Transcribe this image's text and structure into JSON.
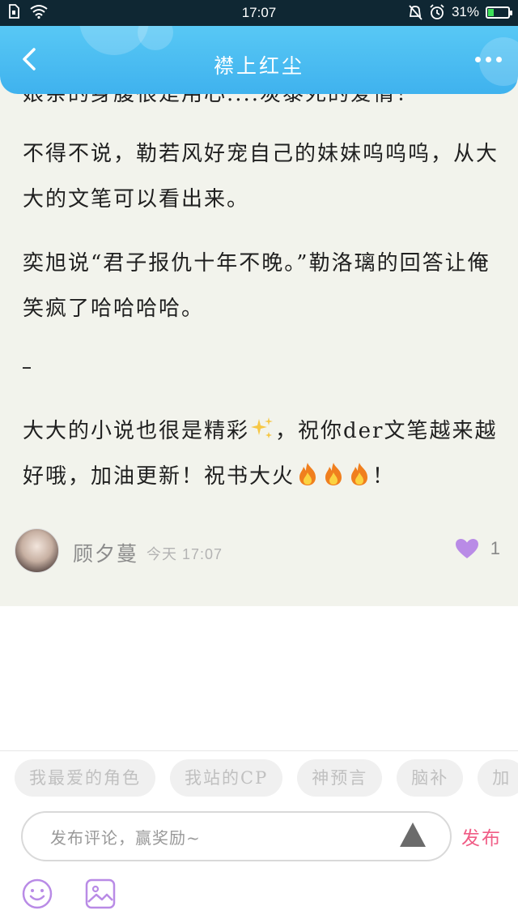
{
  "status_bar": {
    "time": "17:07",
    "battery": "31%",
    "battery_level": 0.31
  },
  "header": {
    "title": "襟上红尘"
  },
  "article": {
    "cut_line": "娘亲的身腹很是用心....炭泰死的爱情！",
    "paragraphs": [
      "不得不说，勒若风好宠自己的妹妹呜呜呜，从大大的文笔可以看出来。",
      "奕旭说“君子报仇十年不晚。”勒洛璃的回答让俺笑疯了哈哈哈哈。"
    ],
    "final_para": {
      "part1": "大大的小说也很是精彩",
      "part2": "，祝你der文笔越来越好哦，加油更新！祝书大火",
      "part3": "！"
    },
    "emojis": [
      "sparkles-icon",
      "fire-icon",
      "fire-icon",
      "fire-icon"
    ]
  },
  "comment": {
    "author": "顾夕蔓",
    "day": "今天",
    "time": "17:07",
    "likes": "1"
  },
  "colors": {
    "header": "#3fb2ee",
    "card_bg": "#f2f3ec",
    "like": "#b98be6",
    "publish": "#f05d86"
  },
  "tags": [
    "我最爱的角色",
    "我站的CP",
    "神预言",
    "脑补",
    "加"
  ],
  "composer": {
    "placeholder": "发布评论，赢奖励~",
    "publish_label": "发布"
  }
}
